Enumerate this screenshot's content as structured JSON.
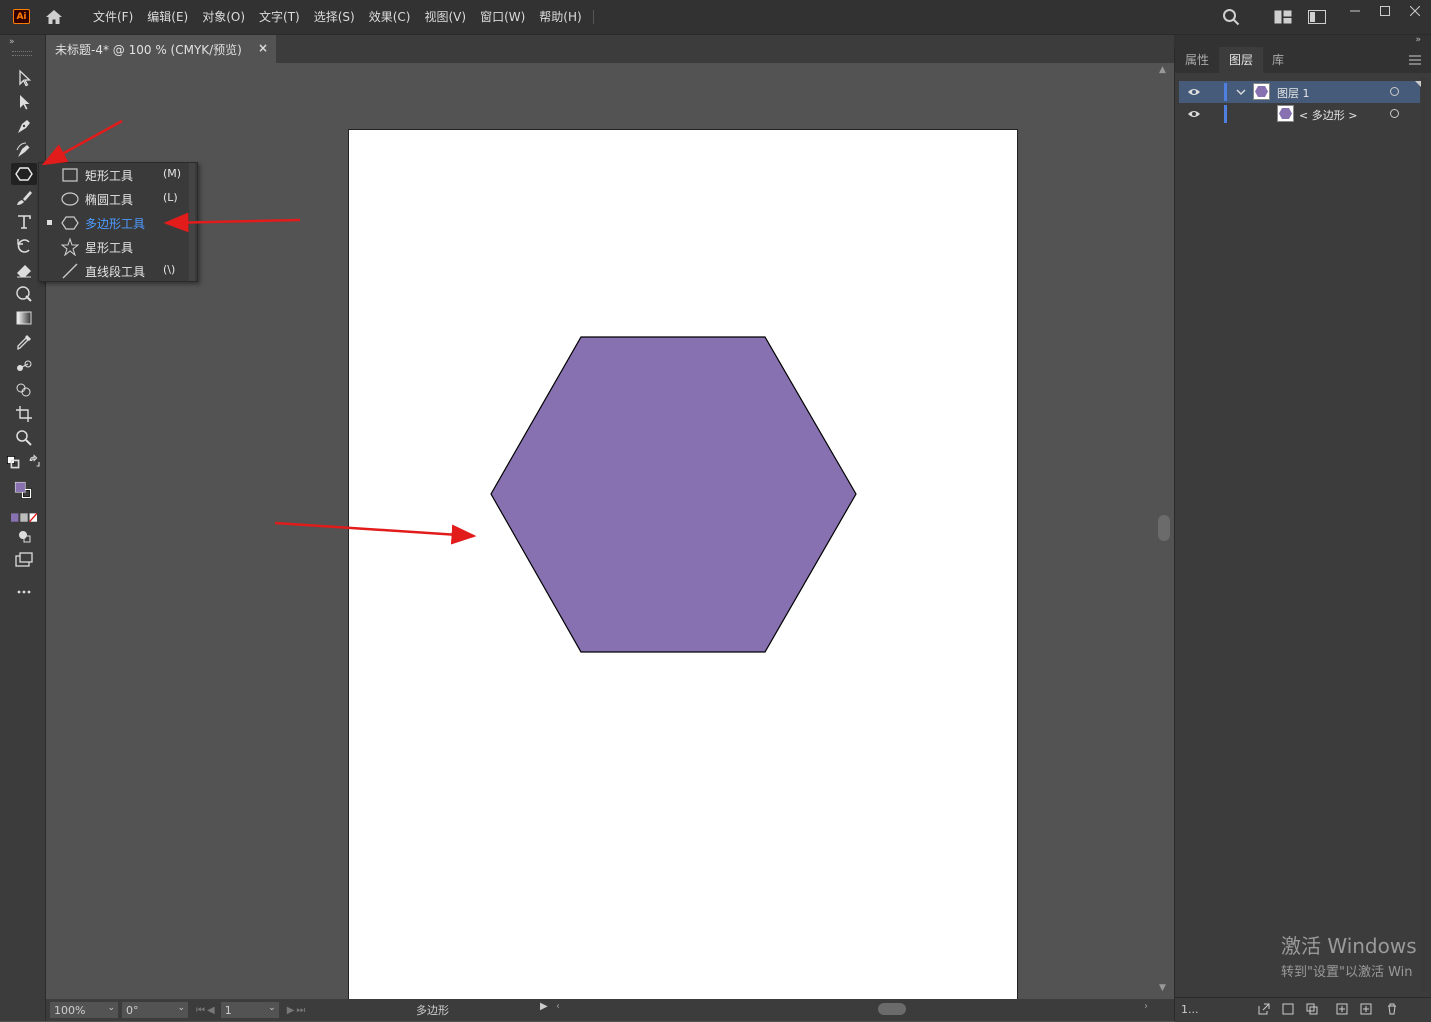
{
  "app": {
    "logo": "Ai"
  },
  "menu": [
    "文件(F)",
    "编辑(E)",
    "对象(O)",
    "文字(T)",
    "选择(S)",
    "效果(C)",
    "视图(V)",
    "窗口(W)",
    "帮助(H)"
  ],
  "document": {
    "tab_title": "未标题-4* @ 100 % (CMYK/预览)",
    "close": "×"
  },
  "flyout": {
    "items": [
      {
        "label": "矩形工具",
        "shortcut": "(M)",
        "icon": "rectangle-icon",
        "selected": false
      },
      {
        "label": "椭圆工具",
        "shortcut": "(L)",
        "icon": "ellipse-icon",
        "selected": false
      },
      {
        "label": "多边形工具",
        "shortcut": "",
        "icon": "polygon-icon",
        "selected": true
      },
      {
        "label": "星形工具",
        "shortcut": "",
        "icon": "star-icon",
        "selected": false
      },
      {
        "label": "直线段工具",
        "shortcut": "(\\)",
        "icon": "line-icon",
        "selected": false
      }
    ]
  },
  "panel": {
    "tabs": [
      "属性",
      "图层",
      "库"
    ],
    "active_tab": "图层",
    "layers": [
      {
        "name": "图层 1",
        "selected": true
      },
      {
        "name": "< 多边形 >",
        "selected": false
      }
    ],
    "layer_count": "1..."
  },
  "status": {
    "zoom": "100%",
    "rotation": "0°",
    "artboard": "1",
    "current_tool": "多边形"
  },
  "shape": {
    "type": "hexagon",
    "fill": "#8771b0",
    "stroke": "#000000"
  },
  "colors": {
    "fill_swatch": "#8771b0",
    "annotation_arrow": "#e21b1b",
    "accent_blue": "#4d9cff"
  },
  "watermark": {
    "line1": "激活 Windows",
    "line2": "转到\"设置\"以激活 Win"
  }
}
